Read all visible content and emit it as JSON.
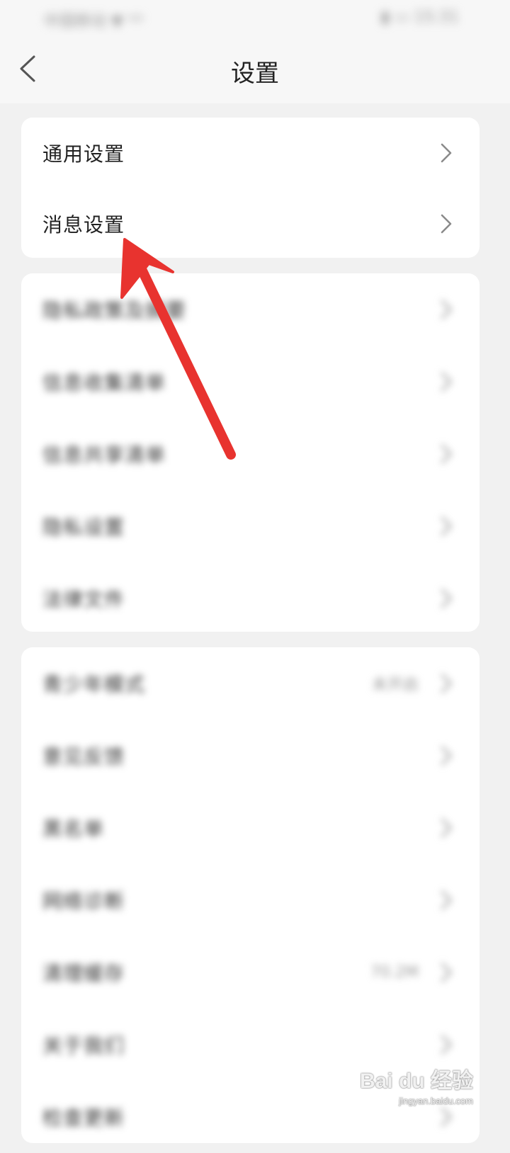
{
  "status_bar": {
    "left_text": "中国移动 ▼ ᴴᴰ",
    "right_text": "▮ ▭ 15:31"
  },
  "header": {
    "title": "设置",
    "back_icon": "chevron-left-icon"
  },
  "groups": [
    {
      "items": [
        {
          "label": "通用设置"
        },
        {
          "label": "消息设置"
        }
      ]
    },
    {
      "blurred": true,
      "items": [
        {
          "label": "隐私政策及摘要"
        },
        {
          "label": "信息收集清单"
        },
        {
          "label": "信息共享清单"
        },
        {
          "label": "隐私设置"
        },
        {
          "label": "法律文件"
        }
      ]
    },
    {
      "blurred": true,
      "items": [
        {
          "label": "青少年模式",
          "value": "未开启"
        },
        {
          "label": "意见反馈"
        },
        {
          "label": "黑名单"
        },
        {
          "label": "网络诊断"
        },
        {
          "label": "清理缓存",
          "value": "70.2M"
        },
        {
          "label": "关于我们"
        },
        {
          "label": "检查更新"
        }
      ]
    }
  ],
  "annotation": {
    "arrow_color": "#e8332f",
    "arrow_target": "消息设置"
  },
  "watermark": {
    "main": "Bai du 经验",
    "sub": "jingyan.baidu.com"
  }
}
